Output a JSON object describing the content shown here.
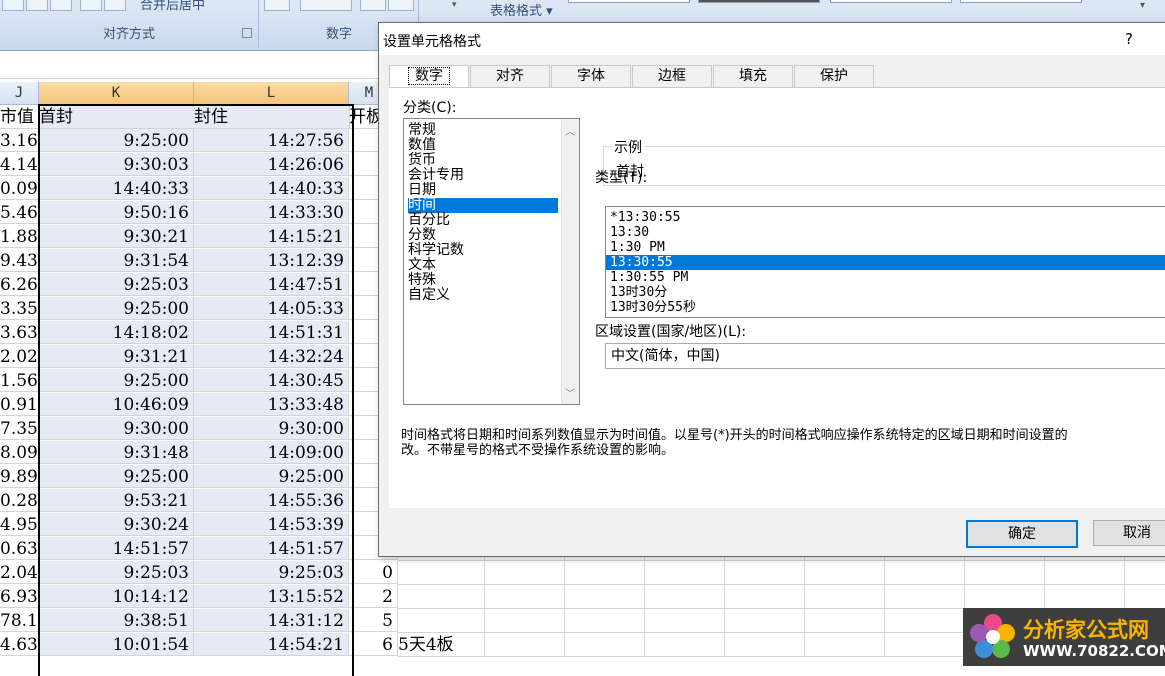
{
  "ribbon": {
    "align_group_label": "对齐方式",
    "number_group_label": "数字",
    "merge_label": "合并后居中",
    "table_format_label": "表格格式"
  },
  "columns": [
    "J",
    "K",
    "L",
    "M"
  ],
  "header_row": {
    "j": "市值",
    "k": "首封",
    "l": "封住",
    "m": "开板"
  },
  "rows": [
    {
      "j": "3.16",
      "k": "9:25:00",
      "l": "14:27:56",
      "m": ""
    },
    {
      "j": "4.14",
      "k": "9:30:03",
      "l": "14:26:06",
      "m": ""
    },
    {
      "j": "0.09",
      "k": "14:40:33",
      "l": "14:40:33",
      "m": ""
    },
    {
      "j": "5.46",
      "k": "9:50:16",
      "l": "14:33:30",
      "m": ""
    },
    {
      "j": "1.88",
      "k": "9:30:21",
      "l": "14:15:21",
      "m": ""
    },
    {
      "j": "9.43",
      "k": "9:31:54",
      "l": "13:12:39",
      "m": ""
    },
    {
      "j": "6.26",
      "k": "9:25:03",
      "l": "14:47:51",
      "m": ""
    },
    {
      "j": "3.35",
      "k": "9:25:00",
      "l": "14:05:33",
      "m": ""
    },
    {
      "j": "3.63",
      "k": "14:18:02",
      "l": "14:51:31",
      "m": ""
    },
    {
      "j": "2.02",
      "k": "9:31:21",
      "l": "14:32:24",
      "m": ""
    },
    {
      "j": "1.56",
      "k": "9:25:00",
      "l": "14:30:45",
      "m": ""
    },
    {
      "j": "0.91",
      "k": "10:46:09",
      "l": "13:33:48",
      "m": ""
    },
    {
      "j": "7.35",
      "k": "9:30:00",
      "l": "9:30:00",
      "m": ""
    },
    {
      "j": "8.09",
      "k": "9:31:48",
      "l": "14:09:00",
      "m": ""
    },
    {
      "j": "9.89",
      "k": "9:25:00",
      "l": "9:25:00",
      "m": ""
    },
    {
      "j": "0.28",
      "k": "9:53:21",
      "l": "14:55:36",
      "m": ""
    },
    {
      "j": "4.95",
      "k": "9:30:24",
      "l": "14:53:39",
      "m": ""
    },
    {
      "j": "0.63",
      "k": "14:51:57",
      "l": "14:51:57",
      "m": ""
    },
    {
      "j": "2.04",
      "k": "9:25:03",
      "l": "9:25:03",
      "m": "0"
    },
    {
      "j": "6.93",
      "k": "10:14:12",
      "l": "13:15:52",
      "m": "2"
    },
    {
      "j": "78.1",
      "k": "9:38:51",
      "l": "14:31:12",
      "m": "5"
    },
    {
      "j": "4.63",
      "k": "10:01:54",
      "l": "14:54:21",
      "m": "6",
      "n": "5天4板"
    }
  ],
  "dialog": {
    "title": "设置单元格格式",
    "help": "?",
    "tabs": [
      "数字",
      "对齐",
      "字体",
      "边框",
      "填充",
      "保护"
    ],
    "category_label": "分类(C):",
    "categories": [
      "常规",
      "数值",
      "货币",
      "会计专用",
      "日期",
      "时间",
      "百分比",
      "分数",
      "科学记数",
      "文本",
      "特殊",
      "自定义"
    ],
    "selected_category": 5,
    "sample_legend": "示例",
    "sample_value": "首封",
    "type_label": "类型(T):",
    "types": [
      "*13:30:55",
      "13:30",
      "1:30 PM",
      "13:30:55",
      "1:30:55 PM",
      "13时30分",
      "13时30分55秒"
    ],
    "selected_type": 3,
    "locale_label": "区域设置(国家/地区)(L):",
    "locale_value": "中文(简体，中国)",
    "description_line1": "时间格式将日期和时间系列数值显示为时间值。以星号(*)开头的时间格式响应操作系统特定的区域日期和时间设置的",
    "description_line2": "改。不带星号的格式不受操作系统设置的影响。",
    "ok": "确定",
    "cancel": "取消"
  },
  "watermark": {
    "name": "分析家公式网",
    "url": "WWW.70822.COM"
  }
}
